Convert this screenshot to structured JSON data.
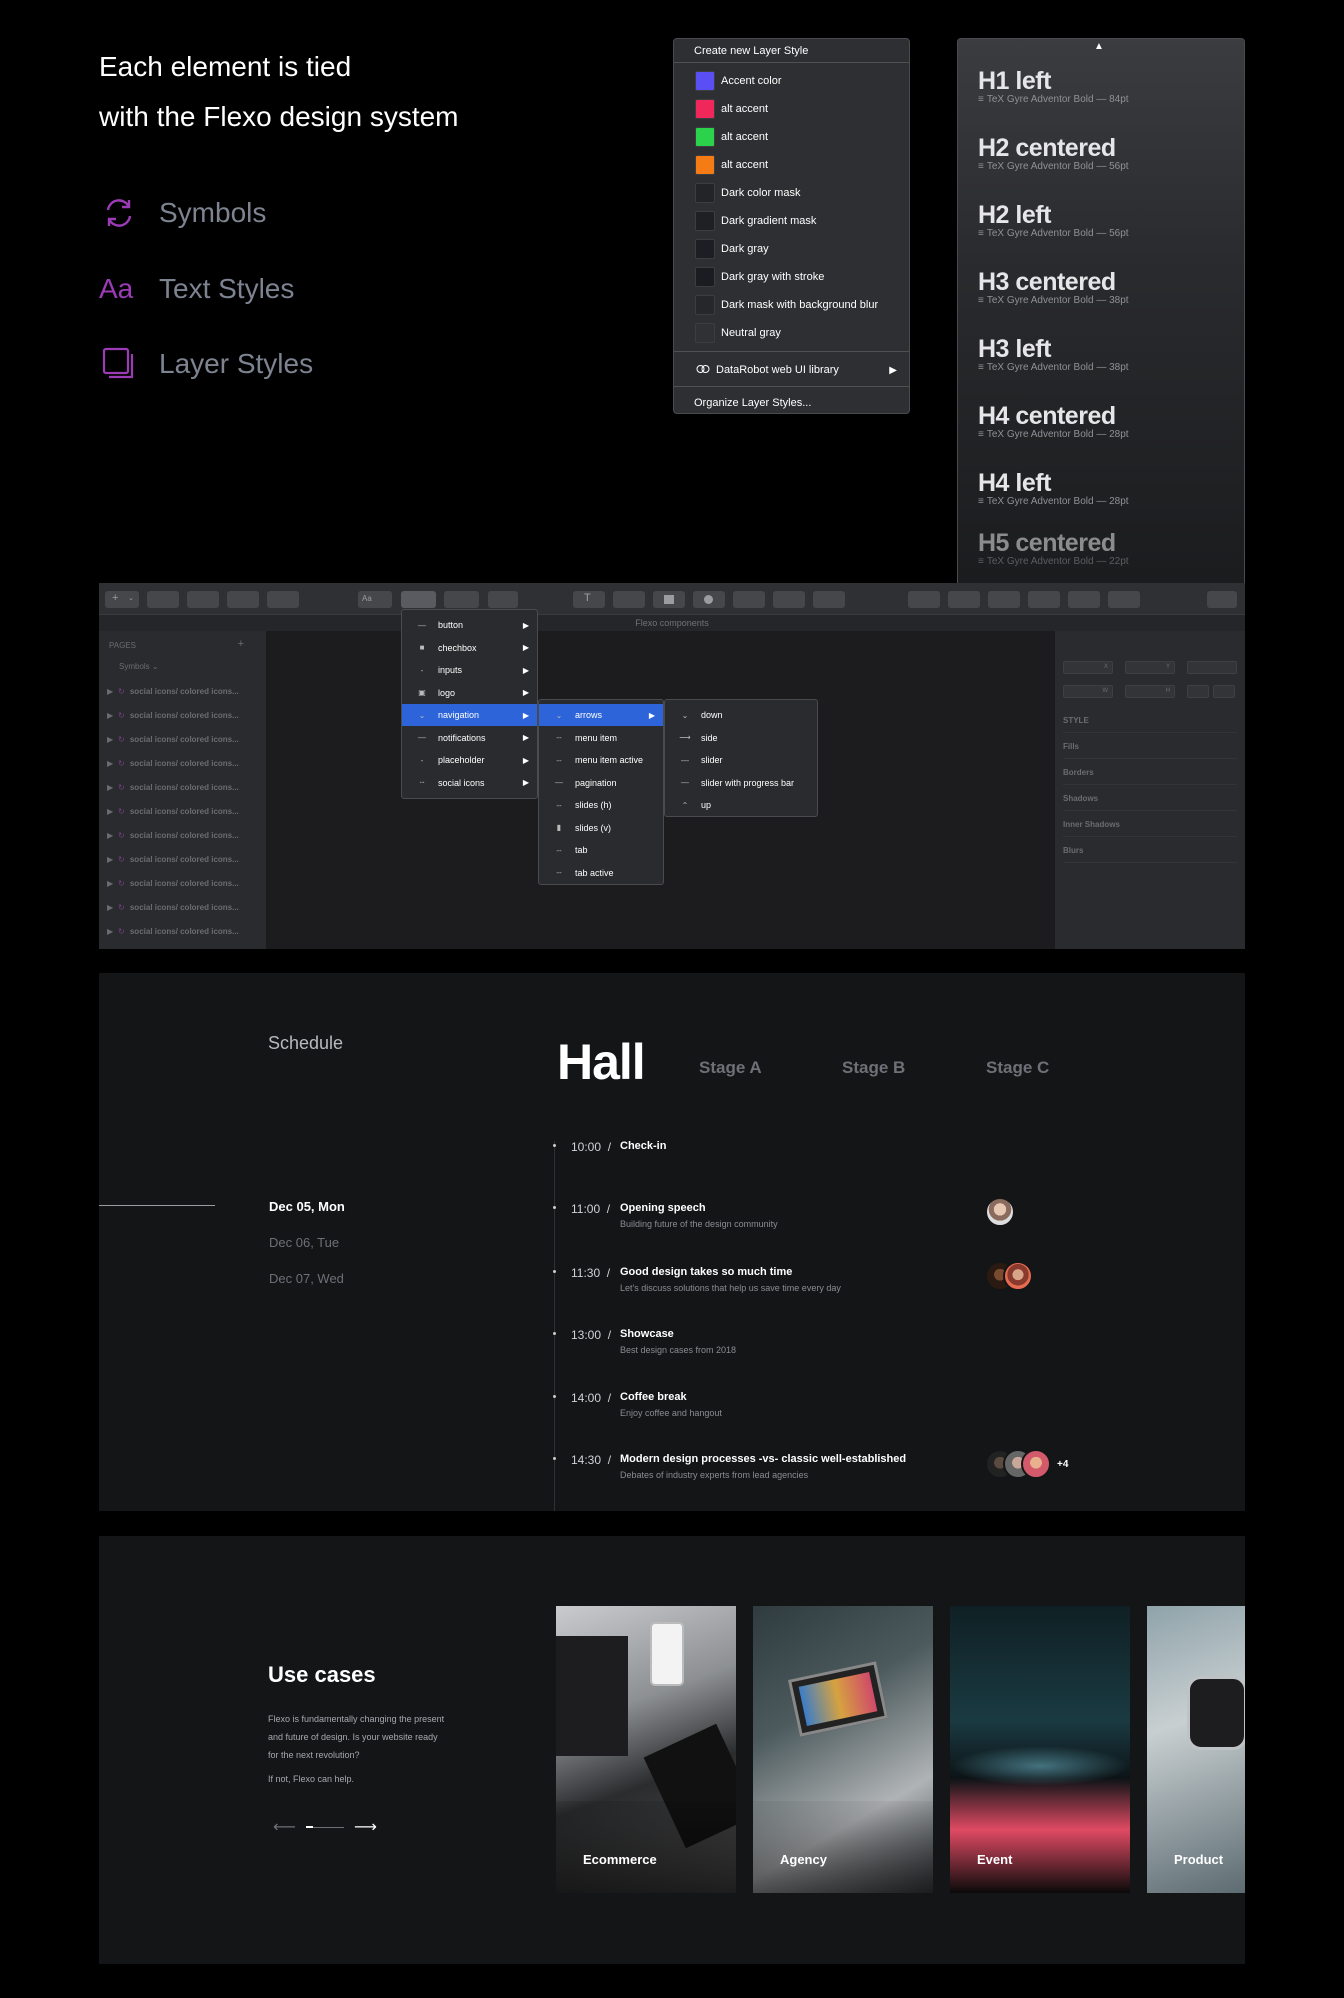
{
  "headline": [
    "Each element is tied",
    "with the Flexo design system"
  ],
  "features": [
    {
      "icon": "symbols-refresh-icon",
      "label": "Symbols"
    },
    {
      "icon": "text-styles-aa-icon",
      "glyph": "Aa",
      "label": "Text Styles"
    },
    {
      "icon": "layer-styles-stack-icon",
      "label": "Layer Styles"
    }
  ],
  "layer_style_menu": {
    "header": "Create new Layer Style",
    "items": [
      {
        "label": "Accent color",
        "color": "#5a4ff5"
      },
      {
        "label": "alt accent",
        "color": "#f0275a"
      },
      {
        "label": "alt accent",
        "color": "#2ad34b"
      },
      {
        "label": "alt accent",
        "color": "#f57c14"
      },
      {
        "label": "Dark color mask",
        "color": "#232427"
      },
      {
        "label": "Dark gradient mask",
        "color": "#1f2023"
      },
      {
        "label": "Dark gray",
        "color": "#1d1e24"
      },
      {
        "label": "Dark gray with stroke",
        "color": "#1b1c22"
      },
      {
        "label": "Dark mask with background blur",
        "color": "#26272a"
      },
      {
        "label": "Neutral gray",
        "color": "#2f3134"
      }
    ],
    "library": "DataRobot web UI library",
    "organize": "Organize Layer Styles..."
  },
  "text_styles": [
    {
      "name": "H1 left",
      "meta": "TeX Gyre Adventor Bold — 84pt"
    },
    {
      "name": "H2 centered",
      "meta": "TeX Gyre Adventor Bold — 56pt"
    },
    {
      "name": "H2 left",
      "meta": "TeX Gyre Adventor Bold — 56pt"
    },
    {
      "name": "H3 centered",
      "meta": "TeX Gyre Adventor Bold — 38pt"
    },
    {
      "name": "H3 left",
      "meta": "TeX Gyre Adventor Bold — 38pt"
    },
    {
      "name": "H4 centered",
      "meta": "TeX Gyre Adventor Bold — 28pt"
    },
    {
      "name": "H4 left",
      "meta": "TeX Gyre Adventor Bold — 28pt"
    },
    {
      "name": "H5 centered",
      "meta": "TeX Gyre Adventor Bold — 22pt"
    }
  ],
  "sketch": {
    "document_title": "Flexo components",
    "pages_header": "PAGES",
    "symbols_label": "Symbols",
    "layer_rows": [
      "social icons/ colored icons...",
      "social icons/ colored icons...",
      "social icons/ colored icons...",
      "social icons/ colored icons...",
      "social icons/ colored icons...",
      "social icons/ colored icons...",
      "social icons/ colored icons...",
      "social icons/ colored icons...",
      "social icons/ colored icons...",
      "social icons/ colored icons...",
      "social icons/ colored icons..."
    ],
    "text_menu_label": "Aa",
    "menu1": [
      "button",
      "chechbox",
      "inputs",
      "logo",
      "navigation",
      "notifications",
      "placeholder",
      "social icons"
    ],
    "menu2": [
      "arrows",
      "menu item",
      "menu item active",
      "pagination",
      "slides (h)",
      "slides (v)",
      "tab",
      "tab active"
    ],
    "menu3": [
      "down",
      "side",
      "slider",
      "slider with progress bar",
      "up"
    ],
    "inspector_fields": [
      "X",
      "Y",
      "W",
      "H"
    ],
    "inspector_header": "STYLE",
    "inspector_sections": [
      "Fills",
      "Borders",
      "Shadows",
      "Inner Shadows",
      "Blurs"
    ]
  },
  "schedule": {
    "label": "Schedule",
    "days": [
      {
        "label": "Dec 05, Mon",
        "active": true
      },
      {
        "label": "Dec 06, Tue",
        "active": false
      },
      {
        "label": "Dec 07, Wed",
        "active": false
      }
    ],
    "hall": "Hall",
    "stages": [
      "Stage A",
      "Stage B",
      "Stage C"
    ],
    "events": [
      {
        "time": "10:00",
        "title": "Check-in",
        "desc": ""
      },
      {
        "time": "11:00",
        "title": "Opening speech",
        "desc": "Building future of the design community"
      },
      {
        "time": "11:30",
        "title": "Good design takes so much time",
        "desc": "Let's discuss solutions that help us save time every day"
      },
      {
        "time": "13:00",
        "title": "Showcase",
        "desc": "Best design cases from 2018"
      },
      {
        "time": "14:00",
        "title": "Coffee break",
        "desc": "Enjoy coffee and hangout"
      },
      {
        "time": "14:30",
        "title": "Modern design processes -vs- classic well-established",
        "desc": "Debates of industry experts from lead agencies"
      }
    ],
    "more_speakers": "+4"
  },
  "use_cases": {
    "title": "Use cases",
    "paragraph": "Flexo is fundamentally changing the present and future of design. Is your website ready for the next revolution?",
    "help": "If not, Flexo can help.",
    "prev_icon": "arrow-left-icon",
    "next_icon": "arrow-right-icon",
    "cards": [
      "Ecommerce",
      "Agency",
      "Event",
      "Product"
    ]
  }
}
